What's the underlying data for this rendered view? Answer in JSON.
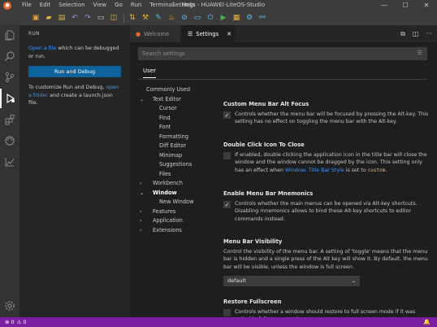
{
  "window": {
    "title": "Settings - HUAWEI-LiteOS-Studio",
    "controls": [
      "—",
      "☐",
      "✕"
    ]
  },
  "menu": [
    "File",
    "Edit",
    "Selection",
    "View",
    "Go",
    "Run",
    "Terminal",
    "Help"
  ],
  "sidebar": {
    "title": "RUN",
    "intro_link": "Open a file",
    "intro_text": " which can be debugged or run.",
    "run_button": "Run and Debug",
    "customize_text_1": "To customize Run and Debug, ",
    "customize_link": "open a folder",
    "customize_text_2": " and create a launch.json file."
  },
  "tabs": [
    {
      "label": "Welcome",
      "active": false
    },
    {
      "label": "Settings",
      "active": true
    }
  ],
  "settings": {
    "search_placeholder": "Search settings",
    "scope_tab": "User",
    "toc": [
      {
        "label": "Commonly Used",
        "indent": 0,
        "chevron": ""
      },
      {
        "label": "Text Editor",
        "indent": 0,
        "chevron": "v"
      },
      {
        "label": "Cursor",
        "indent": 1,
        "chevron": ""
      },
      {
        "label": "Find",
        "indent": 1,
        "chevron": ""
      },
      {
        "label": "Font",
        "indent": 1,
        "chevron": ""
      },
      {
        "label": "Formatting",
        "indent": 1,
        "chevron": ""
      },
      {
        "label": "Diff Editor",
        "indent": 1,
        "chevron": ""
      },
      {
        "label": "Minimap",
        "indent": 1,
        "chevron": ""
      },
      {
        "label": "Suggestions",
        "indent": 1,
        "chevron": ""
      },
      {
        "label": "Files",
        "indent": 1,
        "chevron": ""
      },
      {
        "label": "Workbench",
        "indent": 0,
        "chevron": ">"
      },
      {
        "label": "Window",
        "indent": 0,
        "chevron": "v",
        "bold": true
      },
      {
        "label": "New Window",
        "indent": 1,
        "chevron": ""
      },
      {
        "label": "Features",
        "indent": 0,
        "chevron": ">"
      },
      {
        "label": "Application",
        "indent": 0,
        "chevron": ">"
      },
      {
        "label": "Extensions",
        "indent": 0,
        "chevron": ">"
      }
    ],
    "items": [
      {
        "title": "Custom Menu Bar Alt Focus",
        "checked": true,
        "description": "Controls whether the menu bar will be focused by pressing the Alt-key. This setting has no effect on toggling the menu bar with the Alt-key."
      },
      {
        "title": "Double Click Icon To Close",
        "checked": false,
        "description_1": "If enabled, double clicking the application icon in the title bar will close the window and the window cannot be dragged by the icon. This setting only has an effect when ",
        "link": "Window: Title Bar Style",
        "description_2": " is set to ",
        "code": "custom",
        "description_3": "."
      },
      {
        "title": "Enable Menu Bar Mnemonics",
        "checked": true,
        "description": "Controls whether the main menus can be opened via Alt-key shortcuts. Disabling mnemonics allows to bind these Alt-key shortcuts to editor commands instead."
      },
      {
        "title": "Menu Bar Visibility",
        "description": "Control the visibility of the menu bar. A setting of 'toggle' means that the menu bar is hidden and a single press of the Alt key will show it. By default, the menu bar will be visible, unless the window is full screen.",
        "select_value": "default"
      },
      {
        "title": "Restore Fullscreen",
        "checked": false,
        "description": "Controls whether a window should restore to full screen mode if it was exited in full screen mode."
      }
    ]
  },
  "statusbar": {
    "errors": "0",
    "warnings": "0"
  },
  "colors": {
    "statusbar": "#7a1fa2",
    "accent_link": "#3794ff",
    "primary_button": "#0e639c"
  }
}
